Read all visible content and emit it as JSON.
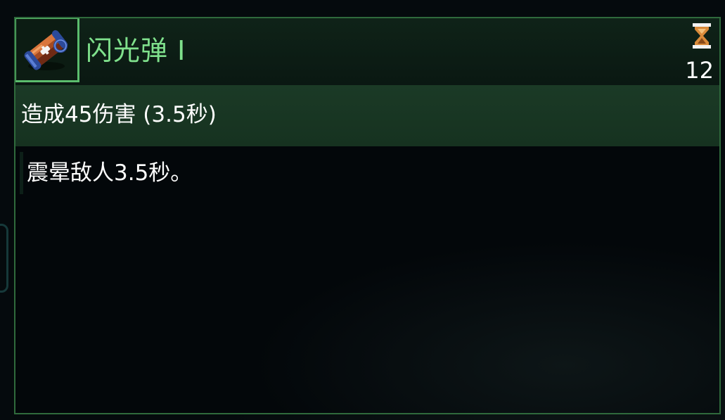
{
  "item": {
    "name": "闪光弹 I",
    "icon": "flashbang-grenade-icon"
  },
  "cooldown": {
    "icon": "hourglass-icon",
    "value": "12"
  },
  "effect": {
    "summary": "造成45伤害 (3.5秒)"
  },
  "description": {
    "text": "震晕敌人3.5秒。"
  },
  "colors": {
    "border": "#2f6a3c",
    "icon_frame": "#5bbd6d",
    "name_text": "#7fe08c",
    "header_bg": "#0f2318",
    "effect_bg": "#1b3a26",
    "body_bg": "#03070a",
    "hourglass": "#d98a3a"
  }
}
